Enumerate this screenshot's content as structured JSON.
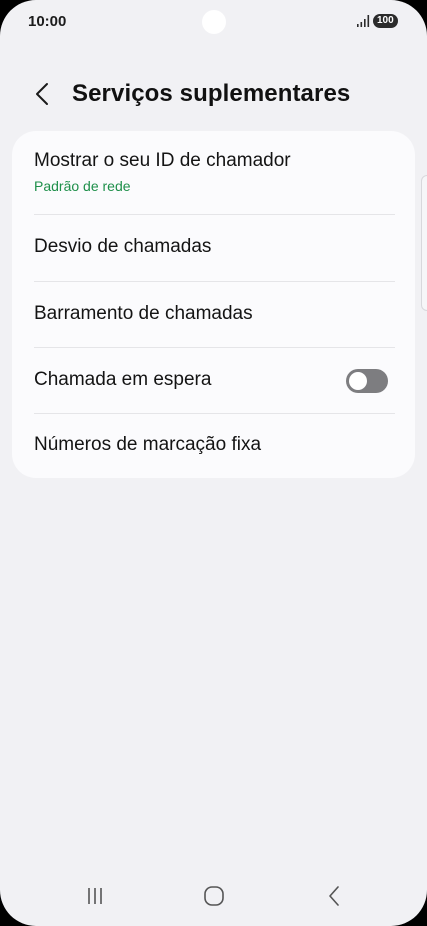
{
  "status_bar": {
    "time": "10:00",
    "battery": "100",
    "signal_icon": "signal-bars-icon"
  },
  "header": {
    "back_icon": "chevron-left-icon",
    "title": "Serviços suplementares"
  },
  "settings": {
    "items": [
      {
        "label": "Mostrar o seu ID de chamador",
        "sublabel": "Padrão de rede"
      },
      {
        "label": "Desvio de chamadas"
      },
      {
        "label": "Barramento de chamadas"
      },
      {
        "label": "Chamada em espera",
        "toggle": false
      },
      {
        "label": "Números de marcação fixa"
      }
    ]
  },
  "nav": {
    "recents_icon": "recent-apps-icon",
    "home_icon": "home-icon",
    "back_icon": "back-icon"
  },
  "colors": {
    "background": "#f1f1f4",
    "card": "#fbfbfd",
    "sublabel": "#1e8f4a",
    "toggle_off": "#7d7d80"
  }
}
